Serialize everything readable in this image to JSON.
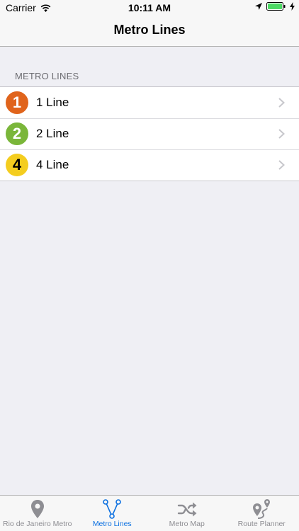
{
  "status_bar": {
    "carrier": "Carrier",
    "time": "10:11 AM",
    "icons": [
      "wifi-icon",
      "location-arrow-icon",
      "battery-icon",
      "charging-bolt-icon"
    ]
  },
  "nav": {
    "title": "Metro Lines"
  },
  "section": {
    "header": "METRO LINES"
  },
  "lines": [
    {
      "badge": "1",
      "label": "1 Line",
      "color": "#e0641c",
      "text_color": "#ffffff"
    },
    {
      "badge": "2",
      "label": "2 Line",
      "color": "#7ab63a",
      "text_color": "#ffffff"
    },
    {
      "badge": "4",
      "label": "4 Line",
      "color": "#f4cd1f",
      "text_color": "#000000"
    }
  ],
  "tabs": [
    {
      "label": "Rio de Janeiro Metro",
      "icon": "map-pin-icon",
      "active": false
    },
    {
      "label": "Metro Lines",
      "icon": "metro-lines-icon",
      "active": true
    },
    {
      "label": "Metro Map",
      "icon": "shuffle-icon",
      "active": false
    },
    {
      "label": "Route Planner",
      "icon": "route-pins-icon",
      "active": false
    }
  ],
  "colors": {
    "accent": "#0a6fe0",
    "inactive": "#8e8e93",
    "background": "#efeff4"
  }
}
